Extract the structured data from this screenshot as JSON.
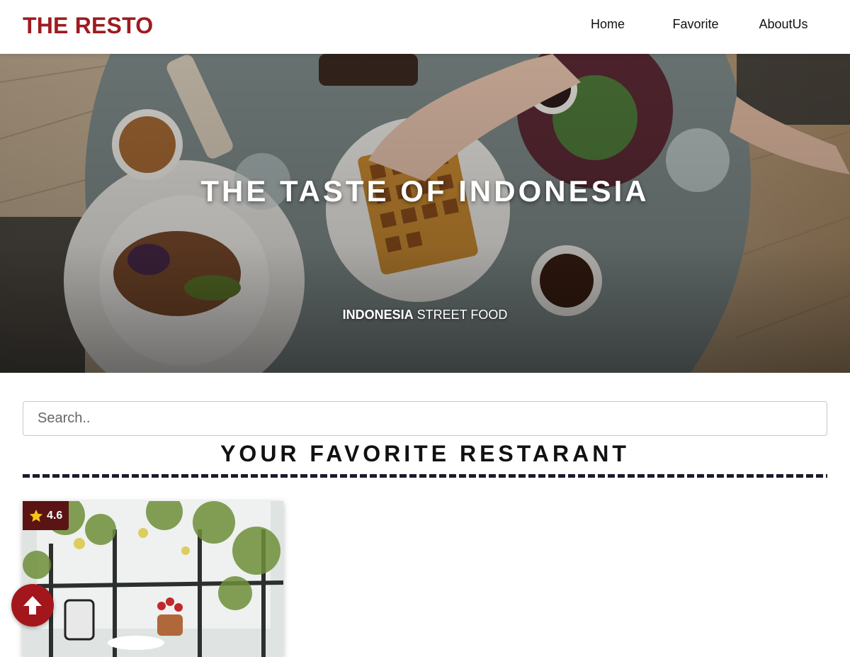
{
  "header": {
    "brand": "THE RESTO",
    "nav": [
      {
        "label": "Home"
      },
      {
        "label": "Favorite"
      },
      {
        "label": "AboutUs"
      }
    ]
  },
  "hero": {
    "title": "THE TASTE OF INDONESIA",
    "tagline_bold": "INDONESIA",
    "tagline_rest": " STREET FOOD"
  },
  "search": {
    "placeholder": "Search..",
    "value": ""
  },
  "section": {
    "title": "YOUR FAVORITE RESTARANT"
  },
  "cards": [
    {
      "rating": "4.6"
    }
  ],
  "icons": {
    "star": "star-icon",
    "scroll_top": "arrow-up-icon"
  },
  "colors": {
    "brand": "#9e1b1f",
    "badge": "#5a1414",
    "star": "#f5c518",
    "scroll_button": "#a3161c",
    "dash": "#1a1a2e"
  }
}
